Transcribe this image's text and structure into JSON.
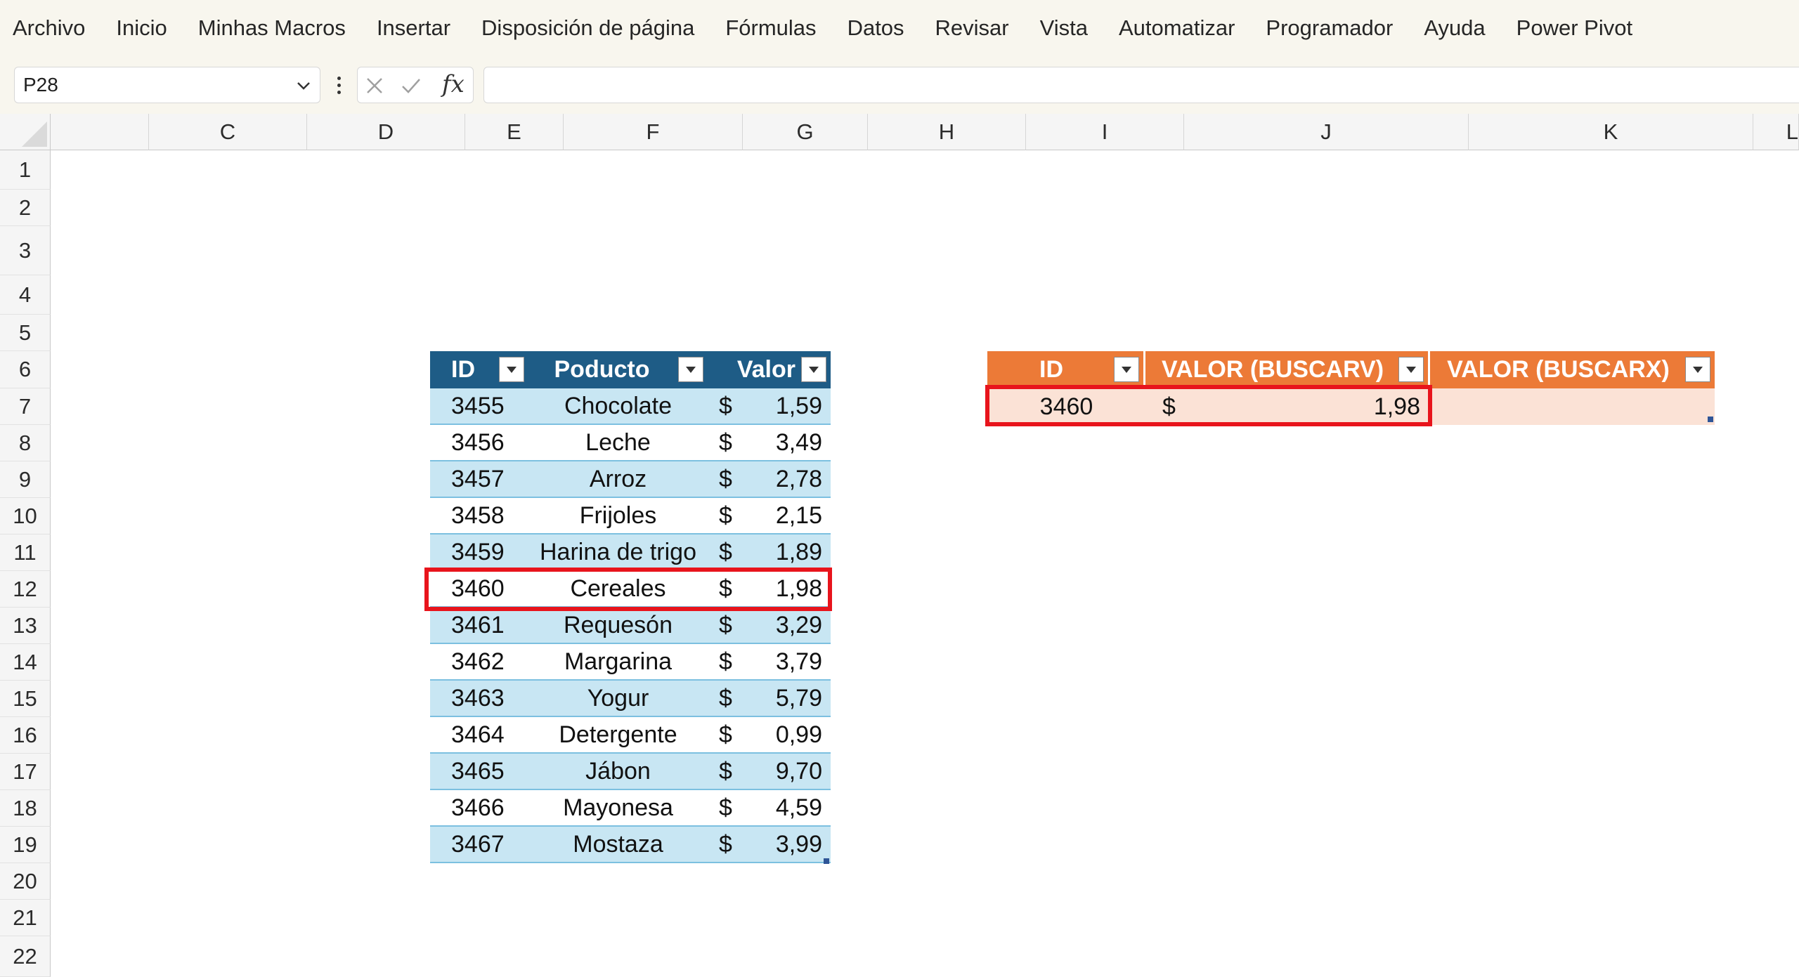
{
  "menu": [
    "Archivo",
    "Inicio",
    "Minhas Macros",
    "Insertar",
    "Disposición de página",
    "Fórmulas",
    "Datos",
    "Revisar",
    "Vista",
    "Automatizar",
    "Programador",
    "Ayuda",
    "Power Pivot"
  ],
  "formula_bar": {
    "name_box": "P28",
    "fx_label": "fx",
    "formula": ""
  },
  "columns": [
    "C",
    "D",
    "E",
    "F",
    "G",
    "H",
    "I",
    "J",
    "K",
    "L"
  ],
  "rows": [
    "1",
    "2",
    "3",
    "4",
    "5",
    "6",
    "7",
    "8",
    "9",
    "10",
    "11",
    "12",
    "13",
    "14",
    "15",
    "16",
    "17",
    "18",
    "19",
    "20",
    "21",
    "22"
  ],
  "product_table": {
    "headers": [
      "ID",
      "Poducto",
      "Valor"
    ],
    "currency": "$",
    "rows": [
      {
        "id": "3455",
        "product": "Chocolate",
        "value": "1,59"
      },
      {
        "id": "3456",
        "product": "Leche",
        "value": "3,49"
      },
      {
        "id": "3457",
        "product": "Arroz",
        "value": "2,78"
      },
      {
        "id": "3458",
        "product": "Frijoles",
        "value": "2,15"
      },
      {
        "id": "3459",
        "product": "Harina de trigo",
        "value": "1,89"
      },
      {
        "id": "3460",
        "product": "Cereales",
        "value": "1,98"
      },
      {
        "id": "3461",
        "product": "Requesón",
        "value": "3,29"
      },
      {
        "id": "3462",
        "product": "Margarina",
        "value": "3,79"
      },
      {
        "id": "3463",
        "product": "Yogur",
        "value": "5,79"
      },
      {
        "id": "3464",
        "product": "Detergente",
        "value": "0,99"
      },
      {
        "id": "3465",
        "product": "Jábon",
        "value": "9,70"
      },
      {
        "id": "3466",
        "product": "Mayonesa",
        "value": "4,59"
      },
      {
        "id": "3467",
        "product": "Mostaza",
        "value": "3,99"
      }
    ]
  },
  "lookup_table": {
    "headers": [
      "ID",
      "VALOR (BUSCARV)",
      "VALOR (BUSCARX)"
    ],
    "row": {
      "id": "3460",
      "currency": "$",
      "buscarv": "1,98",
      "buscarx": ""
    }
  },
  "colors": {
    "menu_bg": "#f8f6ee",
    "blue_header": "#1e5c86",
    "blue_band": "#c8e6f3",
    "orange_header": "#ec7a37",
    "orange_band": "#fbe2d6",
    "highlight_red": "#e8141c"
  }
}
